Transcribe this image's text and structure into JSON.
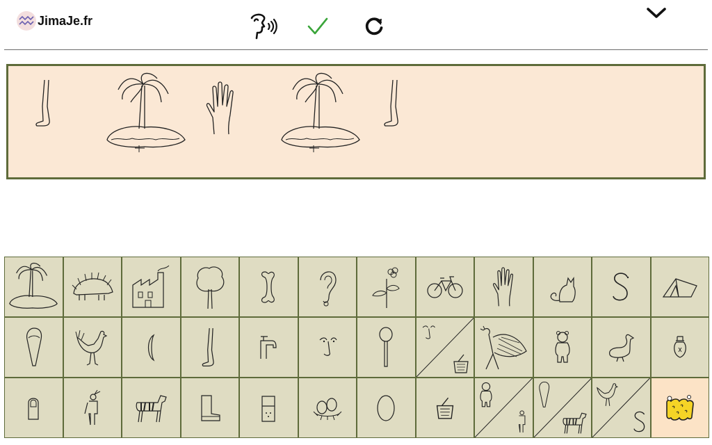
{
  "header": {
    "logo_text": "JimaJe.fr",
    "buttons": [
      {
        "name": "speak-button",
        "icon": "speaking-head-icon"
      },
      {
        "name": "validate-button",
        "icon": "checkmark-icon"
      },
      {
        "name": "reset-button",
        "icon": "refresh-icon"
      },
      {
        "name": "menu-toggle-button",
        "icon": "chevron-down-icon"
      }
    ]
  },
  "sentence": {
    "words": [
      "leg-icon",
      "palm-island-icon",
      "hand-icon",
      "palm-island-icon",
      "leg-icon"
    ]
  },
  "keyboard": {
    "rows": [
      [
        "palm-island-icon",
        "hedgehog-icon",
        "factory-icon",
        "tree-icon",
        "bone-icon",
        "ear-icon",
        "flower-icon",
        "bicycle-icon",
        "hand-icon",
        "cat-icon",
        "snake-s-icon",
        "tent-icon"
      ],
      [
        "nail-finger-icon",
        "rooster-icon",
        "moon-icon",
        "leg-icon",
        "tap-icon",
        "nose-face-icon",
        "lollipop-icon",
        "nose-face-and-pot-icon",
        "peacock-icon",
        "bear-icon",
        "goose-icon",
        "lightbulb-icon"
      ],
      [
        "fingernail-icon",
        "native-person-icon",
        "zebra-icon",
        "boot-icon",
        "box-icon",
        "eggs-in-nest-icon",
        "egg-icon",
        "pot-icon",
        "bear-and-person-icon",
        "nail-and-zebra-icon",
        "rooster-and-snake-icon",
        "sponge-icon"
      ]
    ],
    "selected": "sponge-icon",
    "colors": {
      "cell_bg": "#dfdcc2",
      "cell_border": "#5e6b3a",
      "selected_bg": "#fce3c6"
    }
  },
  "colors": {
    "sentence_bg": "#fbe8d5",
    "sentence_border": "#5e6b3a",
    "check_green": "#3aa53a"
  }
}
